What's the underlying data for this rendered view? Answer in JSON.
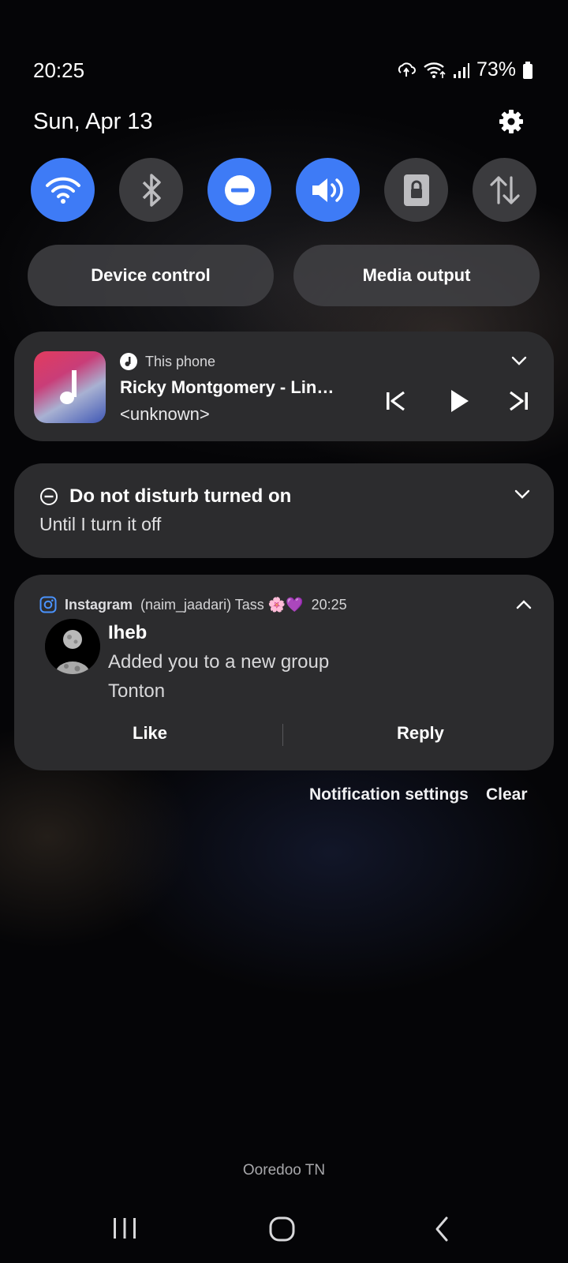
{
  "status_bar": {
    "time": "20:25",
    "battery": "73%",
    "date": "Sun, Apr 13"
  },
  "quick_settings": {
    "toggles": [
      {
        "name": "wifi-icon",
        "state": "on"
      },
      {
        "name": "bluetooth-icon",
        "state": "off"
      },
      {
        "name": "do-not-disturb-icon",
        "state": "on"
      },
      {
        "name": "sound-icon",
        "state": "on"
      },
      {
        "name": "screen-lock-icon",
        "state": "off"
      },
      {
        "name": "mobile-data-icon",
        "state": "off"
      }
    ],
    "device_control": "Device control",
    "media_output": "Media output",
    "accent": "#3e7bf6"
  },
  "media": {
    "source": "This phone",
    "title": "Ricky Montgomery - Line Without a Hook",
    "artist": "<unknown>"
  },
  "dnd": {
    "title": "Do not disturb turned on",
    "subtitle": "Until I turn it off"
  },
  "notification": {
    "app": "Instagram",
    "account": "(naim_jaadari) Tass 🌸💜",
    "time": "20:25",
    "sender": "Iheb",
    "line1": "Added you to a new group",
    "line2": "Tonton",
    "like": "Like",
    "reply": "Reply"
  },
  "footer": {
    "notification_settings": "Notification settings",
    "clear": "Clear",
    "carrier": "Ooredoo TN"
  }
}
